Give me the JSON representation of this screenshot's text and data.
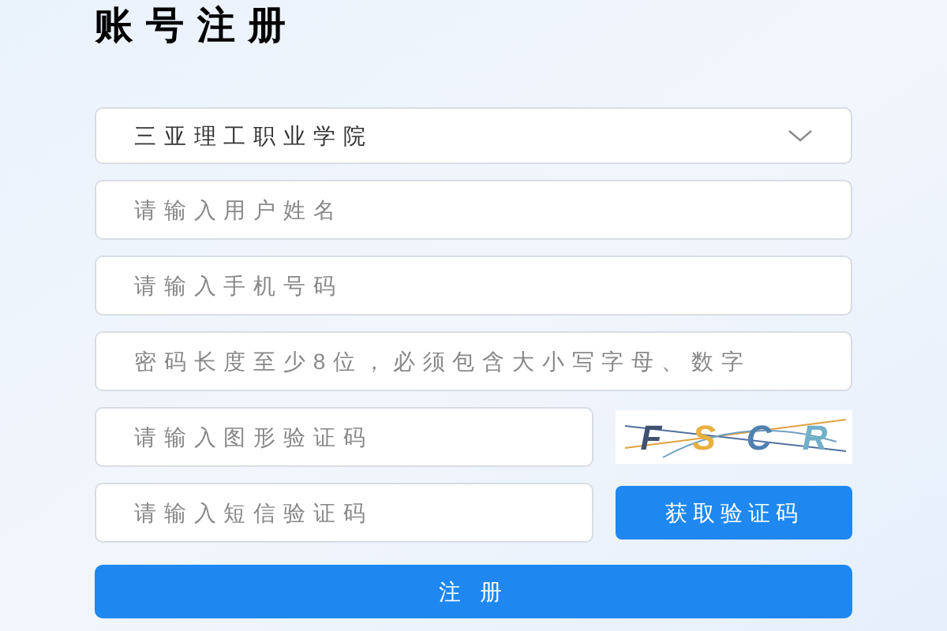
{
  "title": "账号注册",
  "school_select": {
    "value": "三亚理工职业学院"
  },
  "fields": [
    {
      "placeholder": "请输入用户姓名"
    },
    {
      "placeholder": "请输入手机号码"
    },
    {
      "placeholder": "密码长度至少8位，必须包含大小写字母、数字"
    }
  ],
  "captcha": {
    "placeholder": "请输入图形验证码",
    "image_text": [
      "F",
      "S",
      "C",
      "R"
    ]
  },
  "sms": {
    "placeholder": "请输入短信验证码",
    "button": "获取验证码"
  },
  "submit": "注 册"
}
